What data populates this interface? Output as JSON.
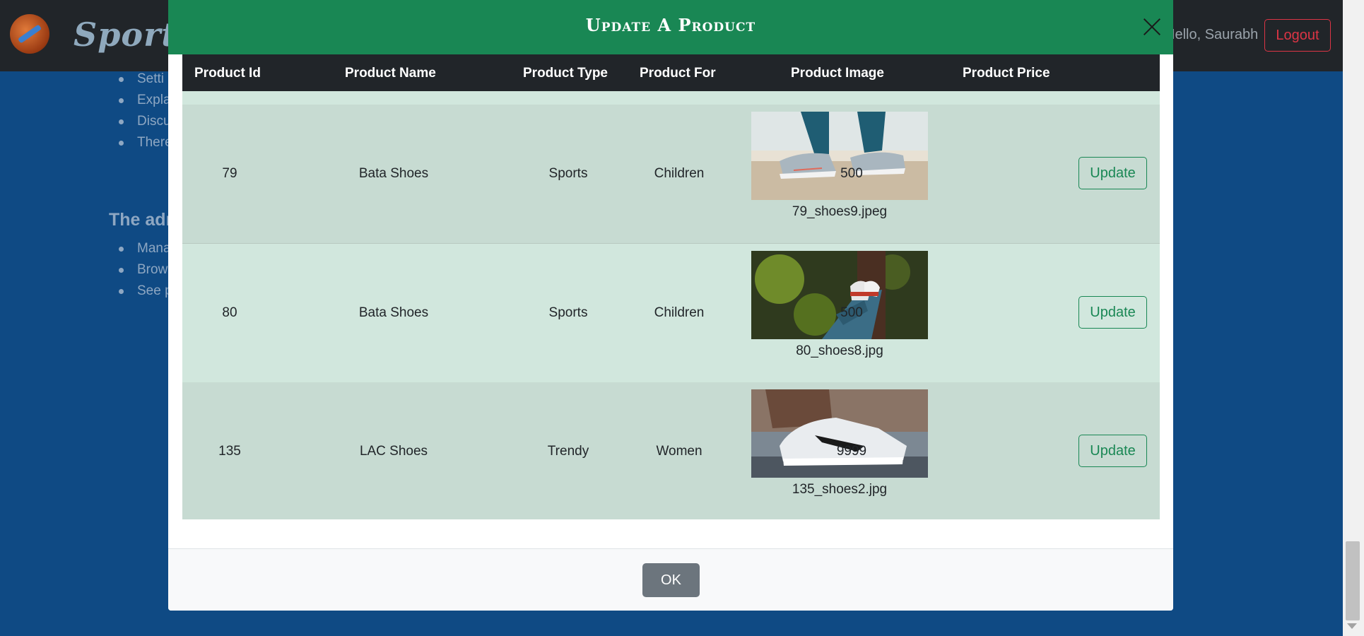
{
  "navbar": {
    "brand": "Sporty",
    "greeting": "Hello, Saurabh",
    "logout_label": "Logout"
  },
  "background": {
    "list1": [
      "Setti",
      "Expla",
      "Discu",
      "There"
    ],
    "heading": "The adm",
    "list2": [
      "Mana",
      "Brow",
      "See p"
    ]
  },
  "modal": {
    "title": "Update A Product",
    "headers": {
      "id": "Product Id",
      "name": "Product Name",
      "type": "Product Type",
      "for": "Product For",
      "image": "Product Image",
      "price": "Product Price"
    },
    "rows": [
      {
        "id": "79",
        "name": "Bata Shoes",
        "type": "Sports",
        "for": "Children",
        "image": "79_shoes9.jpeg",
        "price": "500",
        "action": "Update"
      },
      {
        "id": "80",
        "name": "Bata Shoes",
        "type": "Sports",
        "for": "Children",
        "image": "80_shoes8.jpg",
        "price": "500",
        "action": "Update"
      },
      {
        "id": "135",
        "name": "LAC Shoes",
        "type": "Trendy",
        "for": "Women",
        "image": "135_shoes2.jpg",
        "price": "9999",
        "action": "Update"
      }
    ],
    "ok_label": "OK"
  },
  "colors": {
    "header_green": "#198754",
    "table_head": "#212529",
    "row_dark": "#c7dbd2",
    "row_light": "#d1e7dd",
    "page_bg": "#0f4a84"
  }
}
